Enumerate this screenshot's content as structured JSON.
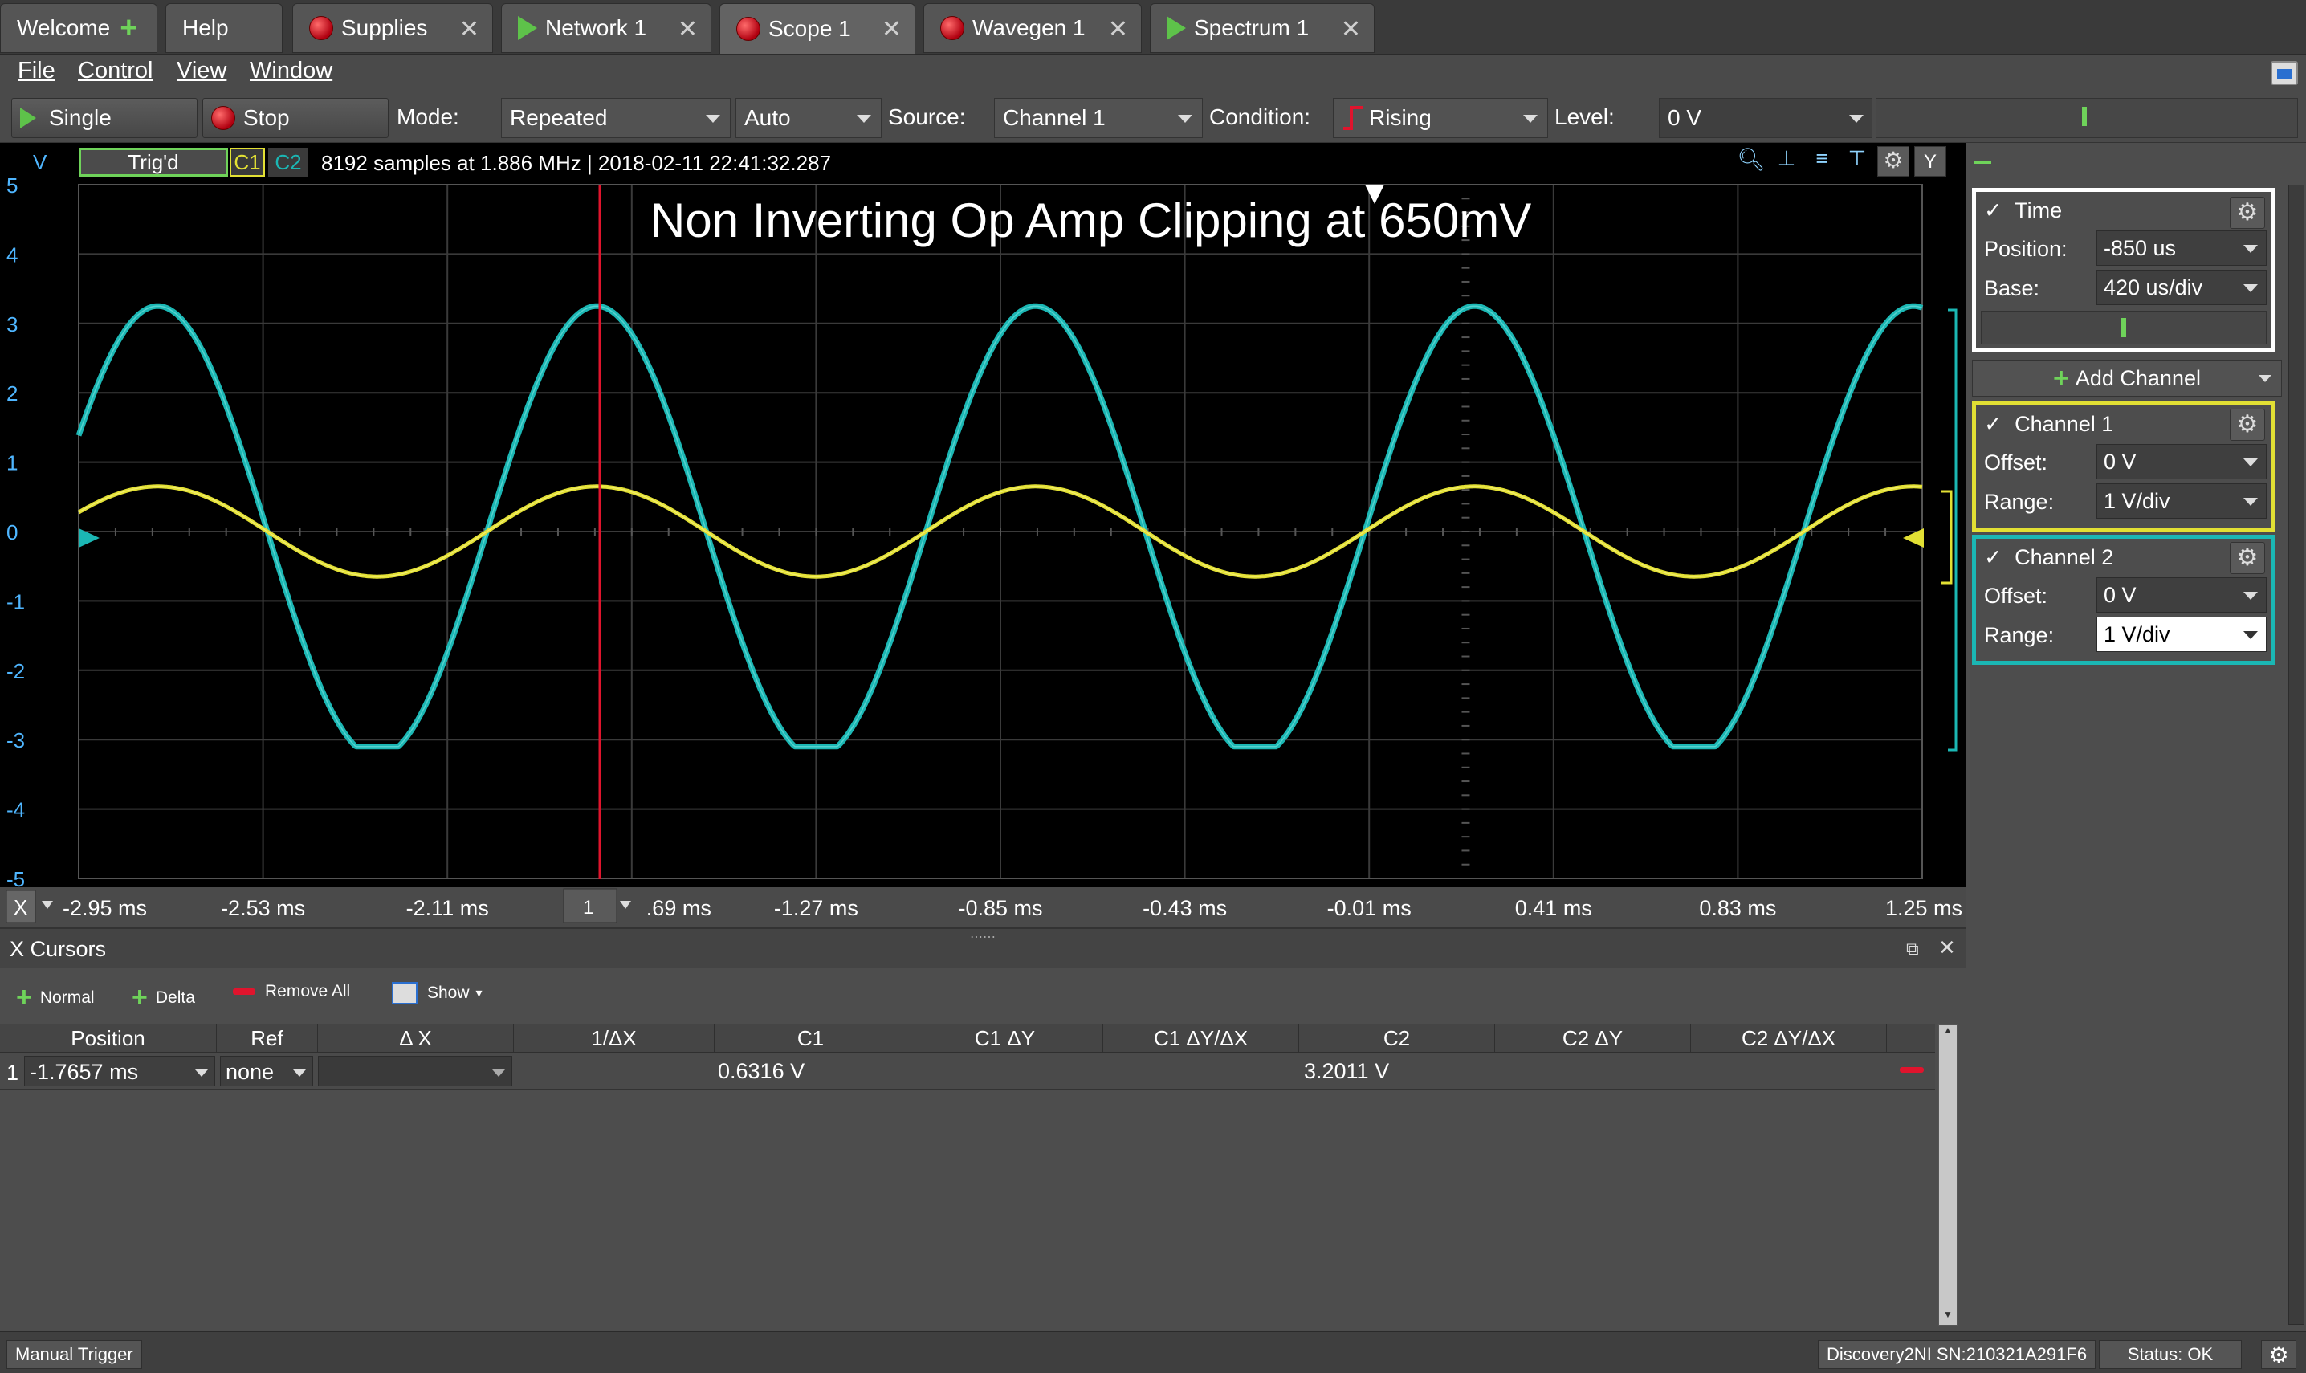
{
  "colors": {
    "c1": "#e2e034",
    "c2": "#1bb7b4",
    "trigger_marker": "#e0142d",
    "accent_green": "#6fd35a"
  },
  "tabs": [
    {
      "label": "Welcome",
      "icon": "plus-icon"
    },
    {
      "label": "Help",
      "icon": ""
    },
    {
      "label": "Supplies",
      "icon": "stop-icon"
    },
    {
      "label": "Network 1",
      "icon": "play-icon"
    },
    {
      "label": "Scope 1",
      "icon": "stop-icon"
    },
    {
      "label": "Wavegen 1",
      "icon": "stop-icon"
    },
    {
      "label": "Spectrum 1",
      "icon": "play-icon"
    }
  ],
  "menu": [
    "File",
    "Control",
    "View",
    "Window"
  ],
  "control": {
    "single_label": "Single",
    "stop_label": "Stop",
    "mode_label": "Mode:",
    "mode_value": "Repeated",
    "auto_value": "Auto",
    "source_label": "Source:",
    "source_value": "Channel 1",
    "condition_label": "Condition:",
    "condition_value": "Rising",
    "level_label": "Level:",
    "level_value": "0 V"
  },
  "plot": {
    "y_unit": "V",
    "status": "Trig'd",
    "c1_tag": "C1",
    "c2_tag": "C2",
    "info": "8192 samples at 1.886 MHz | 2018-02-11 22:41:32.287",
    "title": "Non Inverting Op Amp Clipping at 650mV",
    "y_ticks": [
      "5",
      "4",
      "3",
      "2",
      "1",
      "0",
      "-1",
      "-2",
      "-3",
      "-4",
      "-5"
    ],
    "x_ticks": [
      "-2.95 ms",
      "-2.53 ms",
      "-2.11 ms",
      "-1.69 ms",
      "-1.27 ms",
      "-0.85 ms",
      "-0.43 ms",
      "-0.01 ms",
      "0.41 ms",
      "0.83 ms",
      "1.25 ms"
    ],
    "x_unit_button": "X",
    "zoom_box": "1",
    "y_button": "Y",
    "cursor_time": "-1.7657 ms"
  },
  "chart_data": {
    "type": "line",
    "title": "Non Inverting Op Amp Clipping at 650mV",
    "xlabel": "",
    "ylabel": "V",
    "xlim": [
      -2.95,
      1.25
    ],
    "ylim": [
      -5,
      5
    ],
    "grid": true,
    "series": [
      {
        "name": "C1",
        "waveform": "sine",
        "amplitude": 0.65,
        "period_ms": 1.0,
        "peak_at_ms": [
          -2.77,
          -1.77,
          -0.77,
          0.23,
          1.23
        ],
        "x": [
          -2.95,
          -2.77,
          -2.52,
          -2.27,
          -2.02,
          -1.77,
          -1.52,
          -1.27,
          -1.02,
          -0.77,
          -0.52,
          -0.27,
          -0.02,
          0.23,
          0.48,
          0.73,
          0.98,
          1.23,
          1.25
        ],
        "y": [
          0.35,
          0.65,
          0.0,
          -0.65,
          0.0,
          0.63,
          0.0,
          -0.65,
          0.0,
          0.65,
          0.0,
          -0.65,
          0.0,
          0.65,
          0.0,
          -0.65,
          0.0,
          0.65,
          0.65
        ]
      },
      {
        "name": "C2",
        "waveform": "clipped sine",
        "gain": 5.0,
        "clip_high": 3.3,
        "clip_low": -3.1,
        "x": [
          -2.95,
          -2.77,
          -2.52,
          -2.27,
          -2.02,
          -1.77,
          -1.52,
          -1.27,
          -1.02,
          -0.77,
          -0.52,
          -0.27,
          -0.02,
          0.23,
          0.48,
          0.73,
          0.98,
          1.23,
          1.25
        ],
        "y": [
          1.0,
          3.3,
          0.0,
          -3.1,
          0.0,
          3.2,
          0.0,
          -3.1,
          0.0,
          3.3,
          0.0,
          -3.1,
          0.0,
          3.3,
          0.0,
          -3.1,
          0.0,
          3.3,
          3.3
        ]
      }
    ]
  },
  "right_panel": {
    "time": {
      "title": "Time",
      "position_label": "Position:",
      "position_value": "-850 us",
      "base_label": "Base:",
      "base_value": "420 us/div"
    },
    "add_channel": "Add Channel",
    "ch1": {
      "title": "Channel 1",
      "offset_label": "Offset:",
      "offset_value": "0 V",
      "range_label": "Range:",
      "range_value": "1 V/div"
    },
    "ch2": {
      "title": "Channel 2",
      "offset_label": "Offset:",
      "offset_value": "0 V",
      "range_label": "Range:",
      "range_value": "1 V/div"
    },
    "check": "✓"
  },
  "cursors": {
    "title": "X Cursors",
    "normal": "Normal",
    "delta": "Delta",
    "remove_all": "Remove All",
    "show": "Show",
    "columns": [
      "Position",
      "Ref",
      "Δ X",
      "1/ΔX",
      "C1",
      "C1 ΔY",
      "C1 ΔY/ΔX",
      "C2",
      "C2 ΔY",
      "C2 ΔY/ΔX"
    ],
    "rows": [
      {
        "index": "1",
        "position": "-1.7657 ms",
        "ref": "none",
        "dx": "",
        "inv_dx": "",
        "c1": "0.6316 V",
        "c1_dy": "",
        "c1_dydx": "",
        "c2": "3.2011 V",
        "c2_dy": "",
        "c2_dydx": ""
      }
    ]
  },
  "status": {
    "left": "Manual Trigger",
    "device": "Discovery2NI SN:210321A291F6",
    "state": "Status: OK"
  }
}
